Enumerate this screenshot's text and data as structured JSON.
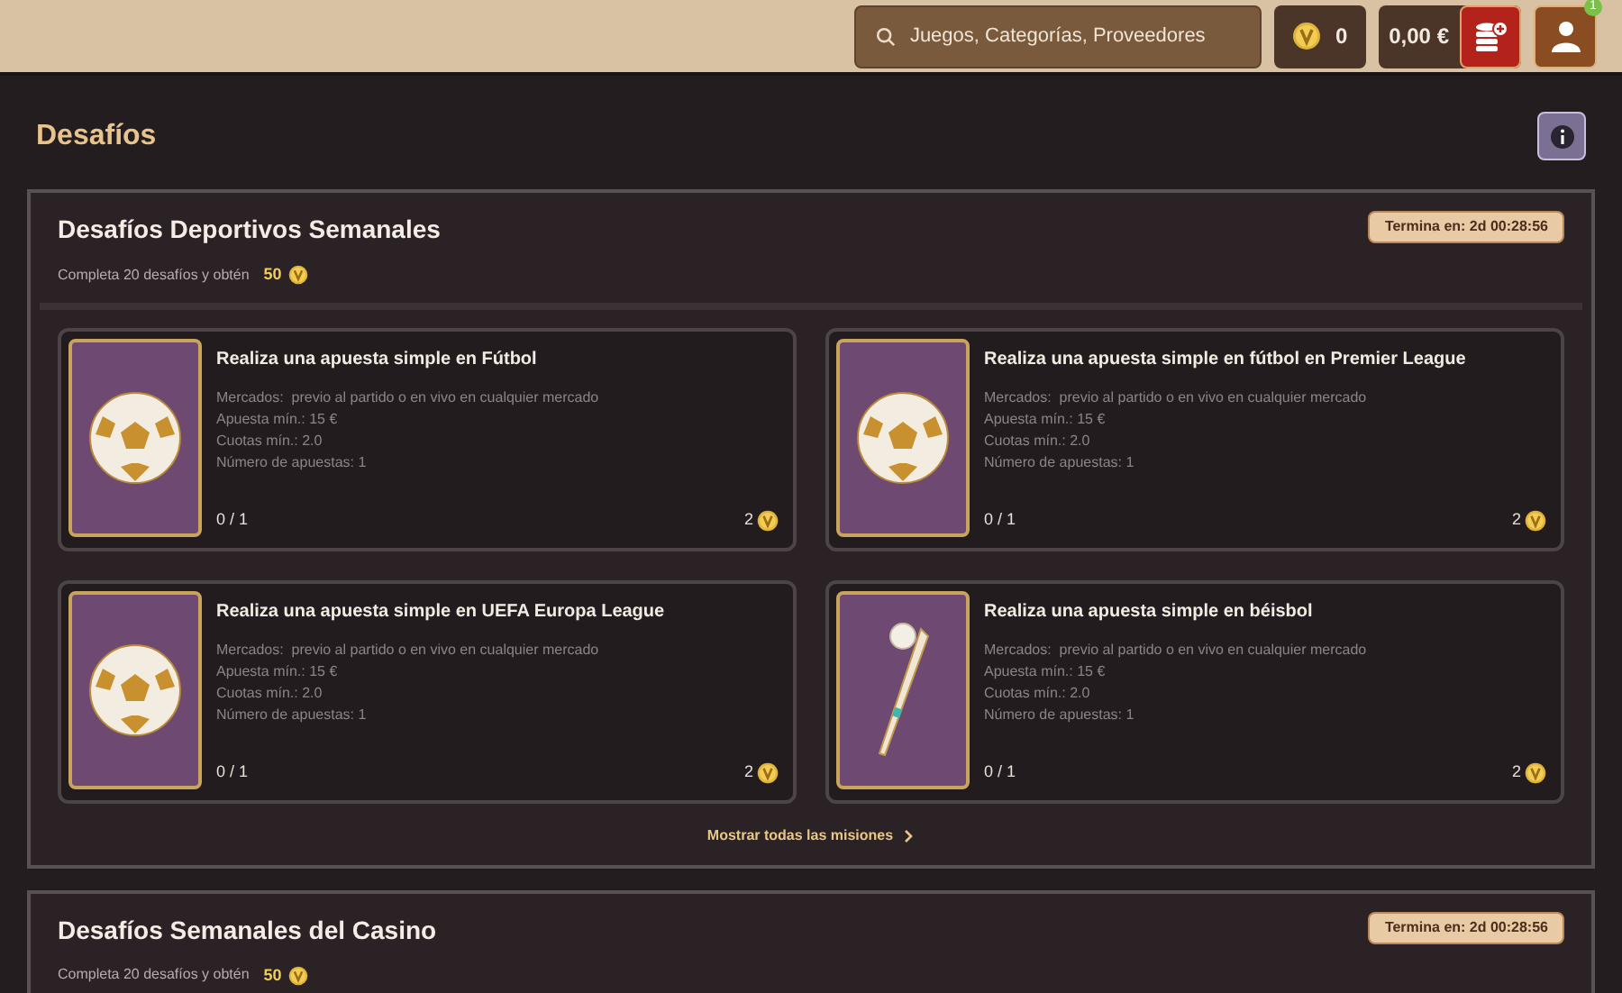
{
  "header": {
    "search": {
      "placeholder": "Juegos, Categorías, Proveedores"
    },
    "coins": "0",
    "balance": "0,00 €",
    "notification_badge": "1"
  },
  "page_title": "Desafíos",
  "sections": [
    {
      "title": "Desafíos Deportivos Semanales",
      "timer": "Termina en: 2d 00:28:56",
      "subtitle": "Completa 20 desafíos y obtén",
      "reward": "50",
      "show_all": "Mostrar todas las misiones",
      "challenges": [
        {
          "kind": "ball",
          "title": "Realiza una apuesta simple en Fútbol",
          "details": [
            "Mercados:  previo al partido o en vivo en cualquier mercado",
            "Apuesta mín.: 15 €",
            "Cuotas mín.: 2.0",
            "Número de apuestas: 1"
          ],
          "progress": "0 / 1",
          "reward": "2"
        },
        {
          "kind": "ball",
          "title": "Realiza una apuesta simple en fútbol en Premier League",
          "details": [
            "Mercados:  previo al partido o en vivo en cualquier mercado",
            "Apuesta mín.: 15 €",
            "Cuotas mín.: 2.0",
            "Número de apuestas: 1"
          ],
          "progress": "0 / 1",
          "reward": "2"
        },
        {
          "kind": "ball",
          "title": "Realiza una apuesta simple en UEFA Europa League",
          "details": [
            "Mercados:  previo al partido o en vivo en cualquier mercado",
            "Apuesta mín.: 15 €",
            "Cuotas mín.: 2.0",
            "Número de apuestas: 1"
          ],
          "progress": "0 / 1",
          "reward": "2"
        },
        {
          "kind": "bat",
          "title": "Realiza una apuesta simple en béisbol",
          "details": [
            "Mercados:  previo al partido o en vivo en cualquier mercado",
            "Apuesta mín.: 15 €",
            "Cuotas mín.: 2.0",
            "Número de apuestas: 1"
          ],
          "progress": "0 / 1",
          "reward": "2"
        }
      ]
    },
    {
      "title": "Desafíos Semanales del Casino",
      "timer": "Termina en: 2d 00:28:56",
      "subtitle": "Completa 20 desafíos y obtén",
      "reward": "50"
    }
  ]
}
